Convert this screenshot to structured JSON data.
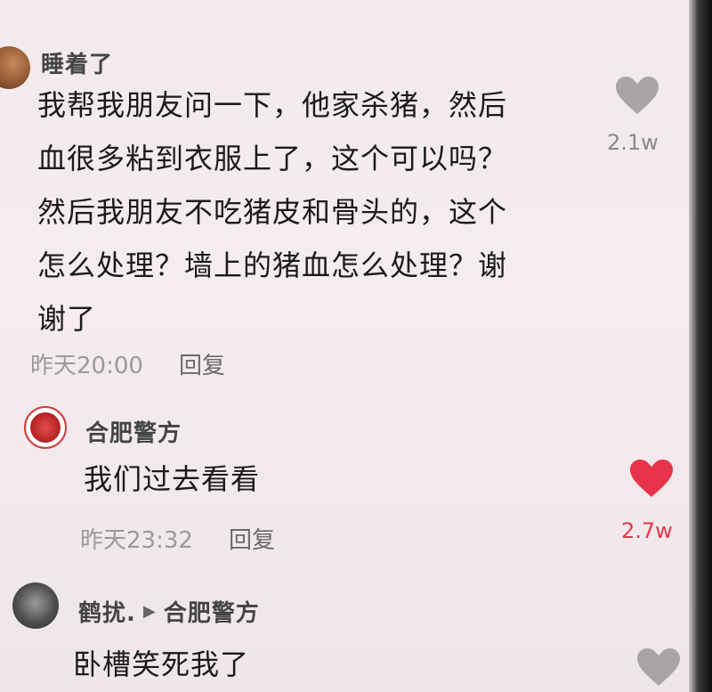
{
  "comments": [
    {
      "username": "睡着了",
      "content_lines": [
        "我帮我朋友问一下，他家杀猪，然后",
        "血很多粘到衣服上了，这个可以吗？",
        "然后我朋友不吃猪皮和骨头的，这个",
        "怎么处理？墙上的猪血怎么处理？谢",
        "谢了"
      ],
      "time": "昨天20:00",
      "reply_label": "回复",
      "likes": "2.1w",
      "liked": false
    },
    {
      "username": "合肥警方",
      "content_lines": [
        "我们过去看看"
      ],
      "time": "昨天23:32",
      "reply_label": "回复",
      "likes": "2.7w",
      "liked": true
    },
    {
      "username": "鹤扰.",
      "reply_to": "合肥警方",
      "content_lines": [
        "卧槽笑死我了"
      ],
      "liked": false
    }
  ],
  "colors": {
    "heart_liked": "#e8344a",
    "heart_unliked": "#a9a4a7",
    "likes_liked": "#e4374a"
  }
}
